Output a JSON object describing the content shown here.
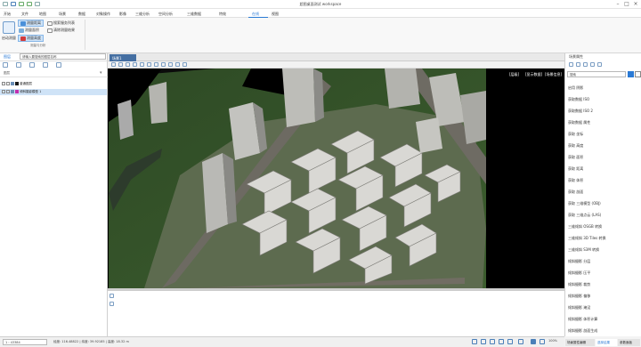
{
  "window": {
    "title": "超图桌面测试 workspace"
  },
  "menu": {
    "items": [
      "开始",
      "文件",
      "地图",
      "场景",
      "数据",
      "对象操作",
      "影像",
      "三维分析",
      "空间分析",
      "三维数据",
      "特效",
      "在线",
      "视图"
    ],
    "active_index": 11
  },
  "ribbon": {
    "start_label": "启动测量",
    "measure_distance": "测量距离",
    "measure_area": "测量面积",
    "measure_height": "测量高度",
    "search_label": "搜索服务列表",
    "clear_label": "清除测量结果",
    "group_label": "测量与分析"
  },
  "left_pane": {
    "tab_label": "图层",
    "search_placeholder": "请输入要搜索的图层名称",
    "section_label": "图层",
    "tree": [
      {
        "label": "普通图层",
        "color": "#1a1a1a"
      },
      {
        "label": "倾斜摄影模型 1",
        "color": "#c02fb0",
        "selected": true
      }
    ]
  },
  "doc": {
    "tab_label": "场景1",
    "overlay_labels": [
      "[层级]",
      "[显示数据]",
      "[场景信息]"
    ]
  },
  "right_pane": {
    "header": "场景属性",
    "search_placeholder": "搜索",
    "tools": [
      "启用 阴影",
      "获取数据 ISO",
      "获取数据 ISO 2",
      "获取数据 属性",
      "获取 坐标",
      "获取 高度",
      "获取 面积",
      "获取 距离",
      "获取 体积",
      "获取 剖面",
      "获取 三维模型 (OBJ)",
      "获取 三维点云 (LAS)",
      "三维倾斜 OSGB 转换",
      "三维倾斜 3D Tiles 转换",
      "三维倾斜 S3M 转换",
      "倾斜摄影 分层",
      "倾斜摄影 压平",
      "倾斜摄影 裁剪",
      "倾斜摄影 偏移",
      "倾斜摄影 淹没",
      "倾斜摄影 体积计算",
      "倾斜摄影 剖面生成"
    ],
    "tabs": [
      "场景属性编辑",
      "选择结果",
      "参数面板"
    ]
  },
  "status": {
    "scale": "1 : 43384",
    "coord_text": "经度: 116.48822 | 纬度: 39.92185 | 高度: 18.32 m",
    "zoom": "100%"
  },
  "colors": {
    "accent": "#2a7ad5",
    "selected_bg": "#cfe3f7",
    "doc_tab": "#456fa2"
  }
}
